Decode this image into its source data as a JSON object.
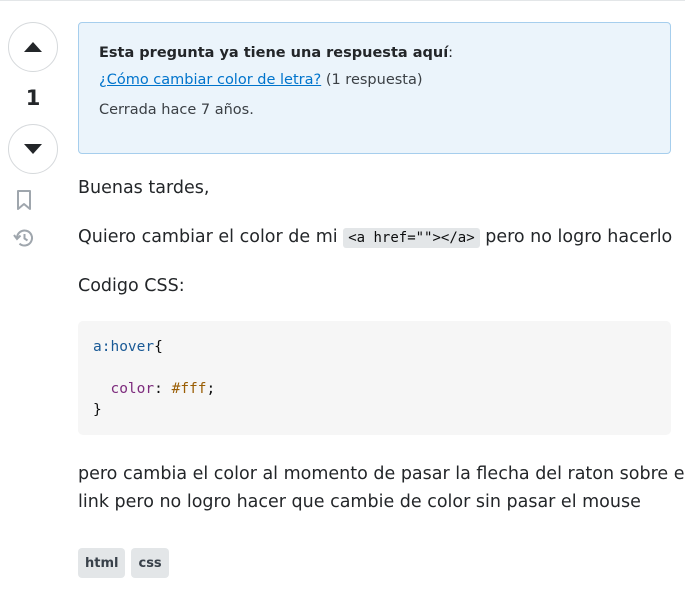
{
  "post": {
    "vote_count": "1",
    "icons": {
      "upvote": "arrow-up-icon",
      "downvote": "arrow-down-icon",
      "bookmark": "bookmark-icon",
      "history": "history-icon"
    }
  },
  "duplicate_notice": {
    "title": "Esta pregunta ya tiene una respuesta aquí",
    "title_suffix": ":",
    "link_text": "¿Cómo cambiar color de letra?",
    "answer_count": "(1 respuesta)",
    "closed_text": "Cerrada hace 7 años."
  },
  "body": {
    "greeting": "Buenas tardes,",
    "p2_before": "Quiero cambiar el color de mi",
    "p2_code": "<a href=\"\"></a>",
    "p2_after": "pero no logro hacerlo",
    "p3": "Codigo CSS:",
    "code": {
      "selector": "a:hover",
      "open_brace": "{",
      "property": "color",
      "colon": ": ",
      "value": "#fff",
      "semicolon": ";",
      "close_brace": "}"
    },
    "p4_line1": "pero cambia el color al momento de pasar la flecha del raton sobre el",
    "p4_line2": "link pero no logro hacer que cambie de color sin pasar el mouse"
  },
  "tags": [
    "html",
    "css"
  ],
  "colors": {
    "notice_bg": "#ebf4fb",
    "notice_border": "#a6ceed",
    "link": "#0074cc",
    "tag_bg": "#e3e6e8",
    "code_bg": "#f6f6f6"
  }
}
